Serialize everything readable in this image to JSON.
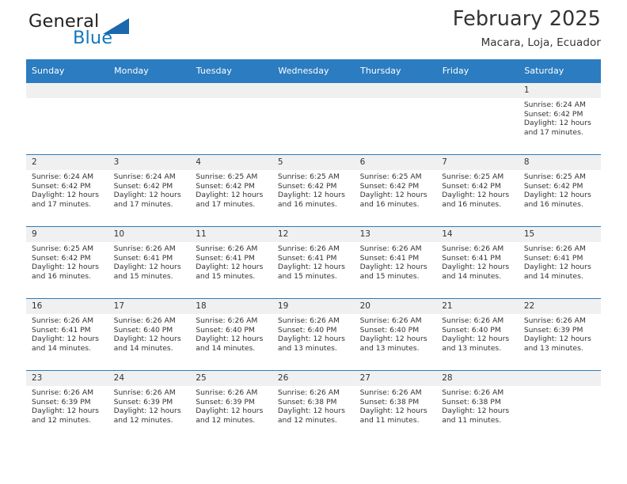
{
  "brand": {
    "name_part1": "General",
    "name_part2": "Blue",
    "triangle_color": "#1b68ad",
    "blue_text_color": "#1278be"
  },
  "header": {
    "title": "February 2025",
    "subtitle": "Macara, Loja, Ecuador"
  },
  "theme": {
    "header_row_bg": "#2b7cc0",
    "header_row_text": "#ffffff",
    "daynum_bg": "#f0f0f0",
    "cell_text": "#333333"
  },
  "weekdays": [
    "Sunday",
    "Monday",
    "Tuesday",
    "Wednesday",
    "Thursday",
    "Friday",
    "Saturday"
  ],
  "labels": {
    "sunrise": "Sunrise:",
    "sunset": "Sunset:",
    "daylight": "Daylight:"
  },
  "weeks": [
    [
      {
        "day": "",
        "empty": true
      },
      {
        "day": "",
        "empty": true
      },
      {
        "day": "",
        "empty": true
      },
      {
        "day": "",
        "empty": true
      },
      {
        "day": "",
        "empty": true
      },
      {
        "day": "",
        "empty": true
      },
      {
        "day": "1",
        "sunrise": "Sunrise: 6:24 AM",
        "sunset": "Sunset: 6:42 PM",
        "daylight": "Daylight: 12 hours and 17 minutes."
      }
    ],
    [
      {
        "day": "2",
        "sunrise": "Sunrise: 6:24 AM",
        "sunset": "Sunset: 6:42 PM",
        "daylight": "Daylight: 12 hours and 17 minutes."
      },
      {
        "day": "3",
        "sunrise": "Sunrise: 6:24 AM",
        "sunset": "Sunset: 6:42 PM",
        "daylight": "Daylight: 12 hours and 17 minutes."
      },
      {
        "day": "4",
        "sunrise": "Sunrise: 6:25 AM",
        "sunset": "Sunset: 6:42 PM",
        "daylight": "Daylight: 12 hours and 17 minutes."
      },
      {
        "day": "5",
        "sunrise": "Sunrise: 6:25 AM",
        "sunset": "Sunset: 6:42 PM",
        "daylight": "Daylight: 12 hours and 16 minutes."
      },
      {
        "day": "6",
        "sunrise": "Sunrise: 6:25 AM",
        "sunset": "Sunset: 6:42 PM",
        "daylight": "Daylight: 12 hours and 16 minutes."
      },
      {
        "day": "7",
        "sunrise": "Sunrise: 6:25 AM",
        "sunset": "Sunset: 6:42 PM",
        "daylight": "Daylight: 12 hours and 16 minutes."
      },
      {
        "day": "8",
        "sunrise": "Sunrise: 6:25 AM",
        "sunset": "Sunset: 6:42 PM",
        "daylight": "Daylight: 12 hours and 16 minutes."
      }
    ],
    [
      {
        "day": "9",
        "sunrise": "Sunrise: 6:25 AM",
        "sunset": "Sunset: 6:42 PM",
        "daylight": "Daylight: 12 hours and 16 minutes."
      },
      {
        "day": "10",
        "sunrise": "Sunrise: 6:26 AM",
        "sunset": "Sunset: 6:41 PM",
        "daylight": "Daylight: 12 hours and 15 minutes."
      },
      {
        "day": "11",
        "sunrise": "Sunrise: 6:26 AM",
        "sunset": "Sunset: 6:41 PM",
        "daylight": "Daylight: 12 hours and 15 minutes."
      },
      {
        "day": "12",
        "sunrise": "Sunrise: 6:26 AM",
        "sunset": "Sunset: 6:41 PM",
        "daylight": "Daylight: 12 hours and 15 minutes."
      },
      {
        "day": "13",
        "sunrise": "Sunrise: 6:26 AM",
        "sunset": "Sunset: 6:41 PM",
        "daylight": "Daylight: 12 hours and 15 minutes."
      },
      {
        "day": "14",
        "sunrise": "Sunrise: 6:26 AM",
        "sunset": "Sunset: 6:41 PM",
        "daylight": "Daylight: 12 hours and 14 minutes."
      },
      {
        "day": "15",
        "sunrise": "Sunrise: 6:26 AM",
        "sunset": "Sunset: 6:41 PM",
        "daylight": "Daylight: 12 hours and 14 minutes."
      }
    ],
    [
      {
        "day": "16",
        "sunrise": "Sunrise: 6:26 AM",
        "sunset": "Sunset: 6:41 PM",
        "daylight": "Daylight: 12 hours and 14 minutes."
      },
      {
        "day": "17",
        "sunrise": "Sunrise: 6:26 AM",
        "sunset": "Sunset: 6:40 PM",
        "daylight": "Daylight: 12 hours and 14 minutes."
      },
      {
        "day": "18",
        "sunrise": "Sunrise: 6:26 AM",
        "sunset": "Sunset: 6:40 PM",
        "daylight": "Daylight: 12 hours and 14 minutes."
      },
      {
        "day": "19",
        "sunrise": "Sunrise: 6:26 AM",
        "sunset": "Sunset: 6:40 PM",
        "daylight": "Daylight: 12 hours and 13 minutes."
      },
      {
        "day": "20",
        "sunrise": "Sunrise: 6:26 AM",
        "sunset": "Sunset: 6:40 PM",
        "daylight": "Daylight: 12 hours and 13 minutes."
      },
      {
        "day": "21",
        "sunrise": "Sunrise: 6:26 AM",
        "sunset": "Sunset: 6:40 PM",
        "daylight": "Daylight: 12 hours and 13 minutes."
      },
      {
        "day": "22",
        "sunrise": "Sunrise: 6:26 AM",
        "sunset": "Sunset: 6:39 PM",
        "daylight": "Daylight: 12 hours and 13 minutes."
      }
    ],
    [
      {
        "day": "23",
        "sunrise": "Sunrise: 6:26 AM",
        "sunset": "Sunset: 6:39 PM",
        "daylight": "Daylight: 12 hours and 12 minutes."
      },
      {
        "day": "24",
        "sunrise": "Sunrise: 6:26 AM",
        "sunset": "Sunset: 6:39 PM",
        "daylight": "Daylight: 12 hours and 12 minutes."
      },
      {
        "day": "25",
        "sunrise": "Sunrise: 6:26 AM",
        "sunset": "Sunset: 6:39 PM",
        "daylight": "Daylight: 12 hours and 12 minutes."
      },
      {
        "day": "26",
        "sunrise": "Sunrise: 6:26 AM",
        "sunset": "Sunset: 6:38 PM",
        "daylight": "Daylight: 12 hours and 12 minutes."
      },
      {
        "day": "27",
        "sunrise": "Sunrise: 6:26 AM",
        "sunset": "Sunset: 6:38 PM",
        "daylight": "Daylight: 12 hours and 11 minutes."
      },
      {
        "day": "28",
        "sunrise": "Sunrise: 6:26 AM",
        "sunset": "Sunset: 6:38 PM",
        "daylight": "Daylight: 12 hours and 11 minutes."
      },
      {
        "day": "",
        "empty": true
      }
    ]
  ]
}
